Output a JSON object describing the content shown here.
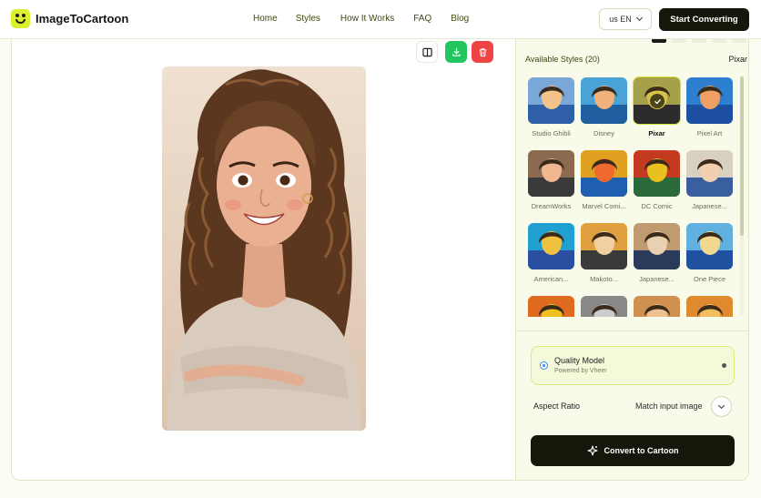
{
  "header": {
    "brand": "ImageToCartoon",
    "nav": [
      "Home",
      "Styles",
      "How It Works",
      "FAQ",
      "Blog"
    ],
    "language": "us EN",
    "start_button": "Start Converting"
  },
  "toolbar": {
    "compare_icon": "compare-icon",
    "download_icon": "download-icon",
    "delete_icon": "trash-icon"
  },
  "styles": {
    "heading": "Available Styles (20)",
    "current": "Pixar",
    "selected": "Pixar",
    "items": [
      {
        "label": "Studio Ghibli"
      },
      {
        "label": "Disney"
      },
      {
        "label": "Pixar"
      },
      {
        "label": "Pixel Art"
      },
      {
        "label": "DreamWorks"
      },
      {
        "label": "Marvel Comi..."
      },
      {
        "label": "DC Comic"
      },
      {
        "label": "Japanese..."
      },
      {
        "label": "American..."
      },
      {
        "label": "Makoto..."
      },
      {
        "label": "Japanese..."
      },
      {
        "label": "One Piece"
      },
      {
        "label": ""
      },
      {
        "label": ""
      },
      {
        "label": ""
      },
      {
        "label": ""
      }
    ]
  },
  "model": {
    "name": "Quality Model",
    "powered_by": "Powered by Vheer"
  },
  "aspect": {
    "label": "Aspect Ratio",
    "value": "Match input image"
  },
  "convert_button": "Convert to Cartoon",
  "colors": {
    "accent": "#d9f02a",
    "dark": "#14170a",
    "download": "#22c55e",
    "delete": "#ef4444"
  }
}
